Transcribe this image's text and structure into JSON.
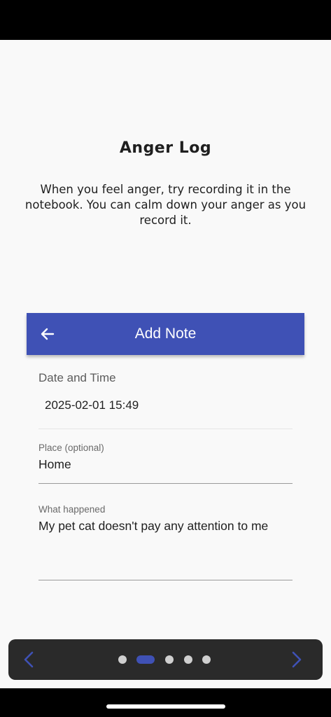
{
  "page": {
    "title": "Anger Log",
    "intro": "When you feel anger, try recording it in the notebook. You can calm down your anger as you record it."
  },
  "card": {
    "header_title": "Add Note",
    "back_icon": "arrow-left-icon",
    "date_section_label": "Date and Time",
    "datetime_value": "2025-02-01 15:49",
    "place_label": "Place (optional)",
    "place_value": "Home",
    "what_label": "What happened",
    "what_value": "My pet cat doesn't pay any attention to me"
  },
  "pager": {
    "prev_icon": "chevron-left-icon",
    "next_icon": "chevron-right-icon",
    "total_pages": 5,
    "current_page": 2
  },
  "colors": {
    "accent": "#3f51b5",
    "screen_bg": "#f9f9f9",
    "pager_bg": "#2a2a2a"
  }
}
